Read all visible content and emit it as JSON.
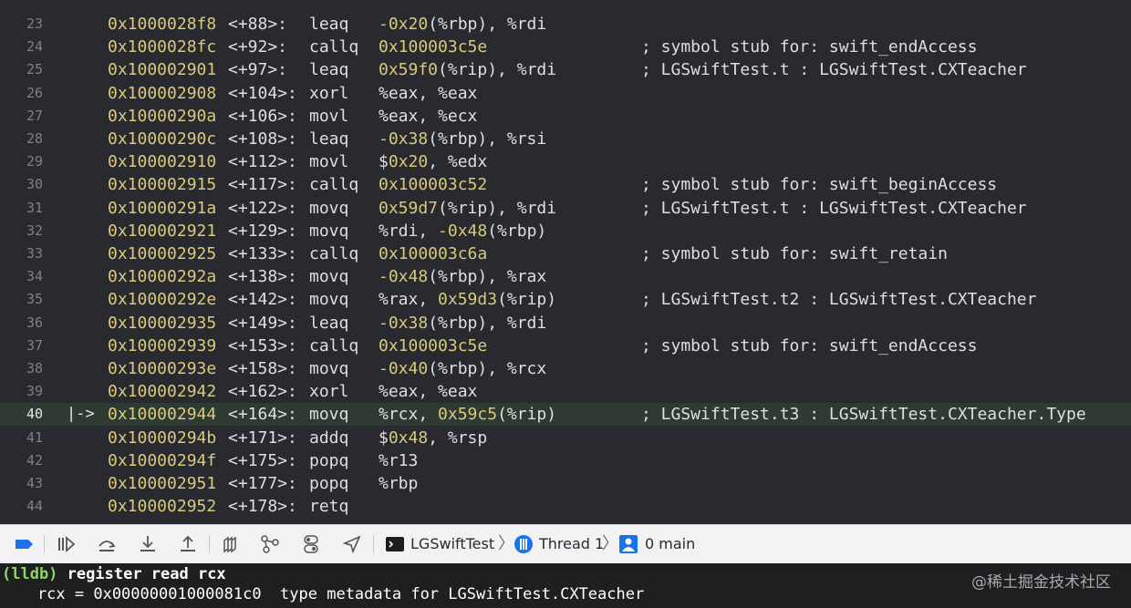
{
  "disassembly": {
    "rows": [
      {
        "ln": "23",
        "addr": "0x1000028f8",
        "off": "<+88>:",
        "mn": "leaq",
        "ops": "-0x20(%rbp), %rdi",
        "cmt": ""
      },
      {
        "ln": "24",
        "addr": "0x1000028fc",
        "off": "<+92>:",
        "mn": "callq",
        "ops": "0x100003c5e",
        "cmt": "; symbol stub for: swift_endAccess"
      },
      {
        "ln": "25",
        "addr": "0x100002901",
        "off": "<+97>:",
        "mn": "leaq",
        "ops": "0x59f0(%rip), %rdi",
        "cmt": "; LGSwiftTest.t : LGSwiftTest.CXTeacher"
      },
      {
        "ln": "26",
        "addr": "0x100002908",
        "off": "<+104>:",
        "mn": "xorl",
        "ops": "%eax, %eax",
        "cmt": ""
      },
      {
        "ln": "27",
        "addr": "0x10000290a",
        "off": "<+106>:",
        "mn": "movl",
        "ops": "%eax, %ecx",
        "cmt": ""
      },
      {
        "ln": "28",
        "addr": "0x10000290c",
        "off": "<+108>:",
        "mn": "leaq",
        "ops": "-0x38(%rbp), %rsi",
        "cmt": ""
      },
      {
        "ln": "29",
        "addr": "0x100002910",
        "off": "<+112>:",
        "mn": "movl",
        "ops": "$0x20, %edx",
        "cmt": ""
      },
      {
        "ln": "30",
        "addr": "0x100002915",
        "off": "<+117>:",
        "mn": "callq",
        "ops": "0x100003c52",
        "cmt": "; symbol stub for: swift_beginAccess"
      },
      {
        "ln": "31",
        "addr": "0x10000291a",
        "off": "<+122>:",
        "mn": "movq",
        "ops": "0x59d7(%rip), %rdi",
        "cmt": "; LGSwiftTest.t : LGSwiftTest.CXTeacher"
      },
      {
        "ln": "32",
        "addr": "0x100002921",
        "off": "<+129>:",
        "mn": "movq",
        "ops": "%rdi, -0x48(%rbp)",
        "cmt": ""
      },
      {
        "ln": "33",
        "addr": "0x100002925",
        "off": "<+133>:",
        "mn": "callq",
        "ops": "0x100003c6a",
        "cmt": "; symbol stub for: swift_retain"
      },
      {
        "ln": "34",
        "addr": "0x10000292a",
        "off": "<+138>:",
        "mn": "movq",
        "ops": "-0x48(%rbp), %rax",
        "cmt": ""
      },
      {
        "ln": "35",
        "addr": "0x10000292e",
        "off": "<+142>:",
        "mn": "movq",
        "ops": "%rax, 0x59d3(%rip)",
        "cmt": "; LGSwiftTest.t2 : LGSwiftTest.CXTeacher"
      },
      {
        "ln": "36",
        "addr": "0x100002935",
        "off": "<+149>:",
        "mn": "leaq",
        "ops": "-0x38(%rbp), %rdi",
        "cmt": ""
      },
      {
        "ln": "37",
        "addr": "0x100002939",
        "off": "<+153>:",
        "mn": "callq",
        "ops": "0x100003c5e",
        "cmt": "; symbol stub for: swift_endAccess"
      },
      {
        "ln": "38",
        "addr": "0x10000293e",
        "off": "<+158>:",
        "mn": "movq",
        "ops": "-0x40(%rbp), %rcx",
        "cmt": ""
      },
      {
        "ln": "39",
        "addr": "0x100002942",
        "off": "<+162>:",
        "mn": "xorl",
        "ops": "%eax, %eax",
        "cmt": ""
      },
      {
        "ln": "40",
        "addr": "0x100002944",
        "off": "<+164>:",
        "mn": "movq",
        "ops": "%rcx, 0x59c5(%rip)",
        "cmt": "; LGSwiftTest.t3 : LGSwiftTest.CXTeacher.Type",
        "current": true,
        "arrow": "|->"
      },
      {
        "ln": "41",
        "addr": "0x10000294b",
        "off": "<+171>:",
        "mn": "addq",
        "ops": "$0x48, %rsp",
        "cmt": ""
      },
      {
        "ln": "42",
        "addr": "0x10000294f",
        "off": "<+175>:",
        "mn": "popq",
        "ops": "%r13",
        "cmt": ""
      },
      {
        "ln": "43",
        "addr": "0x100002951",
        "off": "<+177>:",
        "mn": "popq",
        "ops": "%rbp",
        "cmt": ""
      },
      {
        "ln": "44",
        "addr": "0x100002952",
        "off": "<+178>:",
        "mn": "retq",
        "ops": "",
        "cmt": ""
      }
    ]
  },
  "debug_bar": {
    "icons": [
      "breakpoints-toggle-icon",
      "continue-icon",
      "step-over-icon",
      "step-into-icon",
      "step-out-icon",
      "view-hierarchy-icon",
      "memory-graph-icon",
      "environment-overrides-icon",
      "simulate-location-icon"
    ],
    "target": "LGSwiftTest",
    "thread": "Thread 1",
    "frame": "0 main"
  },
  "console": {
    "prompt": "(lldb)",
    "command": "register read rcx",
    "output": "    rcx = 0x00000001000081c0  type metadata for LGSwiftTest.CXTeacher"
  },
  "watermark": "@稀土掘金技术社区",
  "colors": {
    "editor_bg": "#292a30",
    "current_line_bg": "#2f3b32",
    "address": "#d9c97c",
    "text": "#dfdfe0",
    "prompt": "#8fd65c",
    "accent_blue": "#1a73e8"
  }
}
